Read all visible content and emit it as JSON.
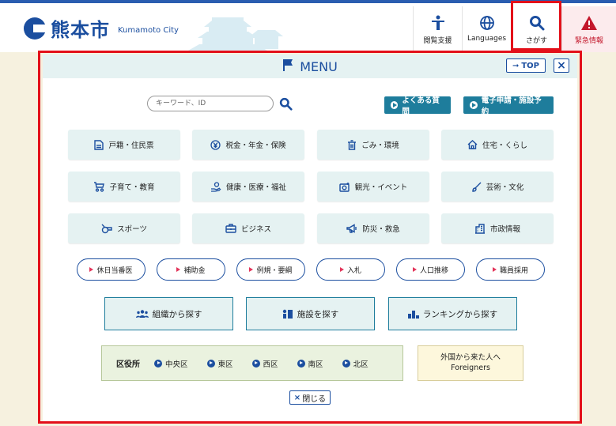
{
  "header": {
    "logo_name": "熊本市",
    "logo_sub": "Kumamoto City",
    "buttons": {
      "accessibility": "閲覧支援",
      "languages": "Languages",
      "search": "さがす",
      "emergency": "緊急情報"
    }
  },
  "menu": {
    "title": "MENU",
    "top_label": "TOP",
    "close_symbol": "×",
    "search_placeholder": "キーワード、ID",
    "faq_label": "よくある質問",
    "apply_label": "電子申請・施設予約",
    "categories": [
      {
        "label": "戸籍・住民票",
        "icon": "document-icon"
      },
      {
        "label": "税金・年金・保険",
        "icon": "yen-icon"
      },
      {
        "label": "ごみ・環境",
        "icon": "trash-icon"
      },
      {
        "label": "住宅・くらし",
        "icon": "house-icon"
      },
      {
        "label": "子育て・教育",
        "icon": "stroller-icon"
      },
      {
        "label": "健康・医療・福祉",
        "icon": "care-hand-icon"
      },
      {
        "label": "観光・イベント",
        "icon": "camera-icon"
      },
      {
        "label": "芸術・文化",
        "icon": "brush-icon"
      },
      {
        "label": "スポーツ",
        "icon": "whistle-icon"
      },
      {
        "label": "ビジネス",
        "icon": "briefcase-icon"
      },
      {
        "label": "防災・救急",
        "icon": "megaphone-icon"
      },
      {
        "label": "市政情報",
        "icon": "building-icon"
      }
    ],
    "pills": [
      "休日当番医",
      "補助金",
      "例規・要綱",
      "入札",
      "人口推移",
      "職員採用"
    ],
    "big_buttons": [
      {
        "label": "組織から探す",
        "icon": "people-icon"
      },
      {
        "label": "施設を探す",
        "icon": "facility-icon"
      },
      {
        "label": "ランキングから探す",
        "icon": "ranking-icon"
      }
    ],
    "ward": {
      "title": "区役所",
      "items": [
        "中央区",
        "東区",
        "西区",
        "南区",
        "北区"
      ]
    },
    "foreign": {
      "line1": "外国から来た人へ",
      "line2": "Foreigners"
    },
    "close_label": "閉じる"
  },
  "colors": {
    "brand_blue": "#1b4e9f",
    "teal": "#1e7d9c",
    "highlight_red": "#e3101a",
    "emergency_red": "#c3172b"
  }
}
